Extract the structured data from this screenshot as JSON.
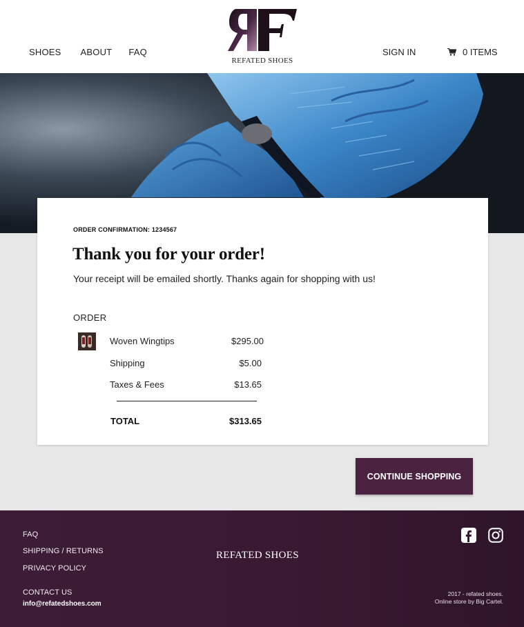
{
  "header": {
    "nav": [
      "SHOES",
      "ABOUT",
      "FAQ"
    ],
    "logo_text": "REFATED SHOES",
    "sign_in": "SIGN IN",
    "cart_label": "0 ITEMS"
  },
  "confirmation": {
    "label": "ORDER CONFIRMATION: 1234567",
    "title": "Thank you for your order!",
    "message": "Your receipt will be emailed shortly. Thanks again for shopping with us!"
  },
  "order": {
    "heading": "ORDER",
    "items": [
      {
        "name": "Woven Wingtips",
        "price": "$295.00"
      }
    ],
    "shipping_label": "Shipping",
    "shipping_amount": "$5.00",
    "taxes_label": "Taxes & Fees",
    "taxes_amount": "$13.65",
    "total_label": "TOTAL",
    "total_amount": "$313.65"
  },
  "continue_label": "CONTINUE SHOPPING",
  "footer": {
    "links": [
      "FAQ",
      "SHIPPING / RETURNS",
      "PRIVACY POLICY"
    ],
    "contact_label": "CONTACT US",
    "email": "info@refatedshoes.com",
    "brand": "REFATED SHOES",
    "copyright": "2017 - refated shoes.",
    "store_credit": "Online store by Big Cartel."
  },
  "colors": {
    "accent": "#4b2341",
    "footer": "#3d1d36"
  },
  "icons": [
    "cart-icon",
    "facebook-icon",
    "instagram-icon"
  ]
}
